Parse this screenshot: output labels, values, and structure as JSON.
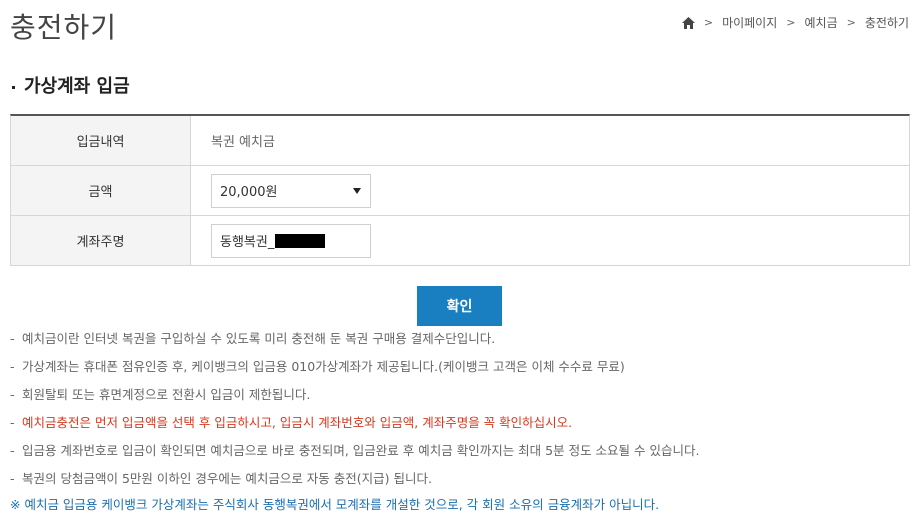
{
  "header": {
    "title": "충전하기",
    "breadcrumb": [
      "마이페이지",
      "예치금",
      "충전하기"
    ],
    "breadcrumb_sep": ">"
  },
  "section": {
    "title": "가상계좌 입금"
  },
  "form": {
    "rows": [
      {
        "label": "입금내역",
        "value": "복권 예치금"
      },
      {
        "label": "금액",
        "selected": "20,000원"
      },
      {
        "label": "계좌주명",
        "value": "동행복권_"
      }
    ]
  },
  "confirm_label": "확인",
  "notes": [
    {
      "dash": "-",
      "text": "예치금이란 인터넷 복권을 구입하실 수 있도록 미리 충전해 둔 복권 구매용 결제수단입니다."
    },
    {
      "dash": "-",
      "text": "가상계좌는 휴대폰 점유인증 후, 케이뱅크의 입금용 010가상계좌가 제공됩니다.(케이뱅크 고객은 이체 수수료 무료)"
    },
    {
      "dash": "-",
      "text": "회원탈퇴 또는 휴면계정으로 전환시 입금이 제한됩니다."
    },
    {
      "dash": "-",
      "text": "예치금충전은 먼저 입금액을 선택 후 입금하시고, 입금시 계좌번호와 입금액, 계좌주명을 꼭 확인하십시오."
    },
    {
      "dash": "-",
      "text": "입금용 계좌번호로 입금이 확인되면 예치금으로 바로 충전되며, 입금완료 후 예치금 확인까지는 최대 5분 정도 소요될 수 있습니다."
    },
    {
      "dash": "-",
      "text": "복권의 당첨금액이 5만원 이하인 경우에는 예치금으로 자동 충전(지급) 됩니다."
    }
  ],
  "footnote": "※ 예치금 입금용 케이뱅크 가상계좌는 주식회사 동행복권에서 모계좌를 개설한 것으로, 각 회원 소유의 금융계좌가 아닙니다.",
  "colors": {
    "accent": "#1a7fc1",
    "warning": "#d9381e",
    "footnote": "#1a6fb0"
  }
}
